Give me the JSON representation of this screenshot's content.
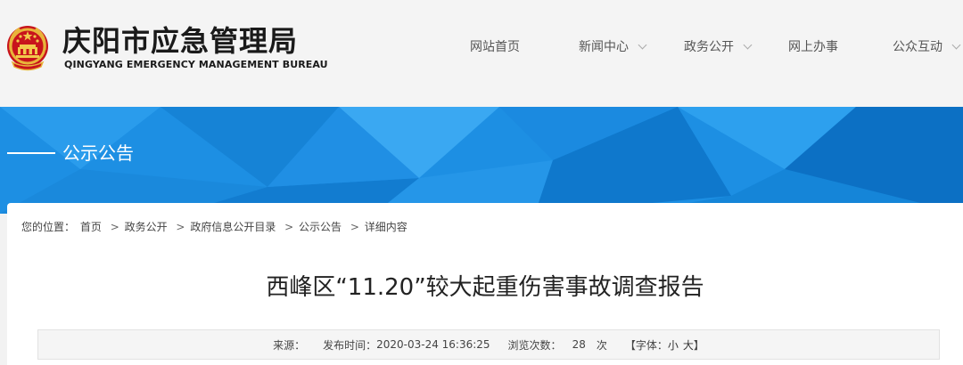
{
  "header": {
    "title_cn": "庆阳市应急管理局",
    "title_en": "QINGYANG EMERGENCY MANAGEMENT BUREAU",
    "emblem_icon": "national-emblem-icon"
  },
  "nav": {
    "items": [
      {
        "label": "网站首页",
        "has_dropdown": false
      },
      {
        "label": "新闻中心",
        "has_dropdown": true
      },
      {
        "label": "政务公开",
        "has_dropdown": true
      },
      {
        "label": "网上办事",
        "has_dropdown": false
      },
      {
        "label": "公众互动",
        "has_dropdown": true
      }
    ]
  },
  "banner": {
    "label": "公示公告",
    "color": "#1d8fe3"
  },
  "breadcrumb": {
    "prefix": "您的位置：",
    "items": [
      "首页",
      "政务公开",
      "政府信息公开目录",
      "公示公告",
      "详细内容"
    ],
    "separator": ">"
  },
  "article": {
    "title": "西峰区“11.20”较大起重伤害事故调查报告"
  },
  "meta": {
    "source_label": "来源：",
    "publish_label": "发布时间：",
    "publish_time": "2020-03-24 16:36:25",
    "views_label": "浏览次数：",
    "views_count": "28",
    "views_unit": "次",
    "font_label": "【字体：",
    "font_small": "小",
    "font_large": "大",
    "font_close": "】"
  }
}
